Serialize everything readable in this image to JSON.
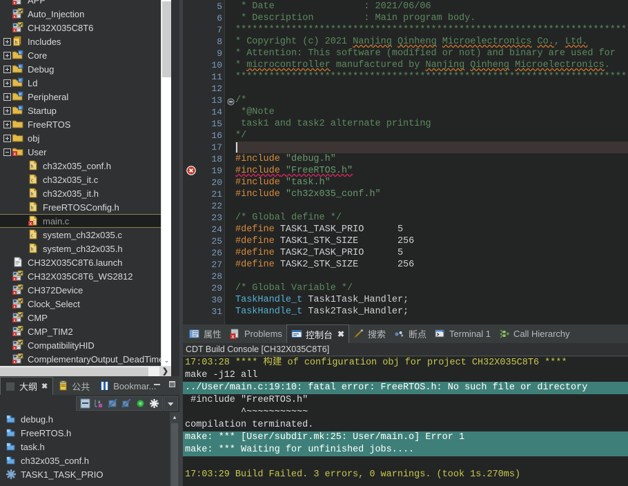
{
  "project_explorer": {
    "tree": [
      {
        "indent": 0,
        "twisty": "none",
        "icon": "project-c-icon",
        "label": "APP",
        "selected": false
      },
      {
        "indent": 0,
        "twisty": "none",
        "icon": "project-c-icon",
        "label": "Auto_Injection",
        "selected": false
      },
      {
        "indent": 0,
        "twisty": "none",
        "icon": "project-c-icon",
        "label": "CH32X035C8T6",
        "selected": false
      },
      {
        "indent": 0,
        "twisty": "expand",
        "icon": "includes-icon",
        "label": "Includes",
        "selected": false
      },
      {
        "indent": 0,
        "twisty": "expand",
        "icon": "src-folder-icon",
        "label": "Core",
        "selected": false
      },
      {
        "indent": 0,
        "twisty": "expand",
        "icon": "src-folder-icon",
        "label": "Debug",
        "selected": false
      },
      {
        "indent": 0,
        "twisty": "expand",
        "icon": "src-folder-icon",
        "label": "Ld",
        "selected": false
      },
      {
        "indent": 0,
        "twisty": "expand",
        "icon": "src-folder-icon",
        "label": "Peripheral",
        "selected": false
      },
      {
        "indent": 0,
        "twisty": "expand",
        "icon": "src-folder-icon",
        "label": "Startup",
        "selected": false
      },
      {
        "indent": 0,
        "twisty": "expand",
        "icon": "folder-icon",
        "label": "FreeRTOS",
        "selected": false
      },
      {
        "indent": 0,
        "twisty": "expand",
        "icon": "folder-icon",
        "label": "obj",
        "selected": false
      },
      {
        "indent": 0,
        "twisty": "collapse",
        "icon": "folder-error-icon",
        "label": "User",
        "selected": false
      },
      {
        "indent": 1,
        "twisty": "none",
        "icon": "h-file-icon",
        "label": "ch32x035_conf.h",
        "selected": false
      },
      {
        "indent": 1,
        "twisty": "none",
        "icon": "c-file-icon",
        "label": "ch32x035_it.c",
        "selected": false
      },
      {
        "indent": 1,
        "twisty": "none",
        "icon": "h-file-icon",
        "label": "ch32x035_it.h",
        "selected": false
      },
      {
        "indent": 1,
        "twisty": "none",
        "icon": "h-file-icon",
        "label": "FreeRTOSConfig.h",
        "selected": false
      },
      {
        "indent": 1,
        "twisty": "none",
        "icon": "c-file-error-icon",
        "label": "main.c",
        "selected": true
      },
      {
        "indent": 1,
        "twisty": "none",
        "icon": "c-file-icon",
        "label": "system_ch32x035.c",
        "selected": false
      },
      {
        "indent": 1,
        "twisty": "none",
        "icon": "h-file-icon",
        "label": "system_ch32x035.h",
        "selected": false
      },
      {
        "indent": 0,
        "twisty": "none",
        "icon": "launch-file-icon",
        "label": "CH32X035C8T6.launch",
        "selected": false
      },
      {
        "indent": 0,
        "twisty": "none",
        "icon": "project-c-icon",
        "label": "CH32X035C8T6_WS2812",
        "selected": false
      },
      {
        "indent": 0,
        "twisty": "none",
        "icon": "project-c-icon",
        "label": "CH372Device",
        "selected": false
      },
      {
        "indent": 0,
        "twisty": "none",
        "icon": "project-c-icon",
        "label": "Clock_Select",
        "selected": false
      },
      {
        "indent": 0,
        "twisty": "none",
        "icon": "project-c-icon",
        "label": "CMP",
        "selected": false
      },
      {
        "indent": 0,
        "twisty": "none",
        "icon": "project-c-icon",
        "label": "CMP_TIM2",
        "selected": false
      },
      {
        "indent": 0,
        "twisty": "none",
        "icon": "project-c-icon",
        "label": "CompatibilityHID",
        "selected": false
      },
      {
        "indent": 0,
        "twisty": "none",
        "icon": "project-c-icon",
        "label": "ComplementaryOutput_DeadTime",
        "selected": false
      }
    ],
    "hscroll_right_arrow": "❯",
    "vscroll_down_arrow": "⌄"
  },
  "outline": {
    "tabs": [
      {
        "label": "大纲",
        "icon": "outline-icon",
        "active": true,
        "closable": true
      },
      {
        "label": "公共",
        "icon": "clipboard-icon",
        "active": false,
        "closable": false
      },
      {
        "label": "Bookmar...",
        "icon": "bookmark-icon",
        "active": false,
        "closable": false
      }
    ],
    "window_buttons": [
      "minimize",
      "maximize"
    ],
    "toolbar_icons": [
      "collapse-all-icon",
      "sort-icon",
      "hide-fields-icon",
      "hide-static-icon",
      "hide-nonpublic-icon",
      "hide-macros-icon"
    ],
    "menu_icon": "view-menu-icon",
    "items": [
      {
        "icon": "include-icon",
        "label": "debug.h"
      },
      {
        "icon": "include-icon",
        "label": "FreeRTOS.h"
      },
      {
        "icon": "include-icon",
        "label": "task.h"
      },
      {
        "icon": "include-icon",
        "label": "ch32x035_conf.h"
      },
      {
        "icon": "macro-icon",
        "label": "TASK1_TASK_PRIO"
      }
    ]
  },
  "editor": {
    "current_line": 17,
    "error_line": 19,
    "fold_line": 13,
    "lines": [
      {
        "n": 5,
        "tokens": [
          {
            "t": " * Date                : 2021/06/06",
            "c": "cm"
          }
        ]
      },
      {
        "n": 6,
        "tokens": [
          {
            "t": " * Description         : Main program body.",
            "c": "cm"
          }
        ]
      },
      {
        "n": 7,
        "tokens": [
          {
            "t": "*******************************************************************************",
            "c": "cm"
          }
        ]
      },
      {
        "n": 8,
        "tokens": [
          {
            "t": "* Copyright (c) 2021 ",
            "c": "cm"
          },
          {
            "t": "Nanjing",
            "c": "cm wavy-orange"
          },
          {
            "t": " ",
            "c": "cm"
          },
          {
            "t": "Qinheng",
            "c": "cm wavy-orange"
          },
          {
            "t": " ",
            "c": "cm"
          },
          {
            "t": "Microelectronics",
            "c": "cm wavy-orange"
          },
          {
            "t": " ",
            "c": "cm"
          },
          {
            "t": "Co.",
            "c": "cm wavy-orange"
          },
          {
            "t": ", ",
            "c": "cm"
          },
          {
            "t": "Ltd.",
            "c": "cm wavy-orange"
          }
        ]
      },
      {
        "n": 9,
        "tokens": [
          {
            "t": "* Attention: This software (modified or not) and binary are used for",
            "c": "cm"
          }
        ]
      },
      {
        "n": 10,
        "tokens": [
          {
            "t": "* ",
            "c": "cm"
          },
          {
            "t": "microcontroller",
            "c": "cm wavy-orange"
          },
          {
            "t": " manufactured by ",
            "c": "cm"
          },
          {
            "t": "Nanjing",
            "c": "cm wavy-orange"
          },
          {
            "t": " ",
            "c": "cm"
          },
          {
            "t": "Qinheng",
            "c": "cm wavy-orange"
          },
          {
            "t": " ",
            "c": "cm"
          },
          {
            "t": "Microelectronics",
            "c": "cm wavy-orange"
          },
          {
            "t": ".",
            "c": "cm"
          }
        ]
      },
      {
        "n": 11,
        "tokens": [
          {
            "t": "*******************************************************************************",
            "c": "cm"
          }
        ]
      },
      {
        "n": 12,
        "tokens": [
          {
            "t": "",
            "c": "pl"
          }
        ]
      },
      {
        "n": 13,
        "tokens": [
          {
            "t": "/*",
            "c": "cm"
          }
        ]
      },
      {
        "n": 14,
        "tokens": [
          {
            "t": " *@Note",
            "c": "cm"
          }
        ]
      },
      {
        "n": 15,
        "tokens": [
          {
            "t": " task1 and task2 alternate printing",
            "c": "cm"
          }
        ]
      },
      {
        "n": 16,
        "tokens": [
          {
            "t": "*/",
            "c": "cm"
          }
        ]
      },
      {
        "n": 17,
        "tokens": [
          {
            "t": "",
            "c": "pl"
          }
        ]
      },
      {
        "n": 18,
        "tokens": [
          {
            "t": "#include",
            "c": "pp"
          },
          {
            "t": " ",
            "c": "pl"
          },
          {
            "t": "\"debug.h\"",
            "c": "str"
          }
        ]
      },
      {
        "n": 19,
        "tokens": [
          {
            "t": "#include",
            "c": "pp wavy-red"
          },
          {
            "t": " ",
            "c": "pl wavy-red"
          },
          {
            "t": "\"FreeRTOS.h\"",
            "c": "str wavy-red"
          }
        ]
      },
      {
        "n": 20,
        "tokens": [
          {
            "t": "#include",
            "c": "pp"
          },
          {
            "t": " ",
            "c": "pl"
          },
          {
            "t": "\"task.h\"",
            "c": "str"
          }
        ]
      },
      {
        "n": 21,
        "tokens": [
          {
            "t": "#include",
            "c": "pp"
          },
          {
            "t": " ",
            "c": "pl"
          },
          {
            "t": "\"ch32x035_conf.h\"",
            "c": "str"
          }
        ]
      },
      {
        "n": 22,
        "tokens": [
          {
            "t": "",
            "c": "pl"
          }
        ]
      },
      {
        "n": 23,
        "tokens": [
          {
            "t": "/* Global define */",
            "c": "cm"
          }
        ]
      },
      {
        "n": 24,
        "tokens": [
          {
            "t": "#define",
            "c": "pp"
          },
          {
            "t": " TASK1_TASK_PRIO      ",
            "c": "pl"
          },
          {
            "t": "5",
            "c": "num"
          }
        ]
      },
      {
        "n": 25,
        "tokens": [
          {
            "t": "#define",
            "c": "pp"
          },
          {
            "t": " TASK1_STK_SIZE       ",
            "c": "pl"
          },
          {
            "t": "256",
            "c": "num"
          }
        ]
      },
      {
        "n": 26,
        "tokens": [
          {
            "t": "#define",
            "c": "pp"
          },
          {
            "t": " TASK2_TASK_PRIO      ",
            "c": "pl"
          },
          {
            "t": "5",
            "c": "num"
          }
        ]
      },
      {
        "n": 27,
        "tokens": [
          {
            "t": "#define",
            "c": "pp"
          },
          {
            "t": " TASK2_STK_SIZE       ",
            "c": "pl"
          },
          {
            "t": "256",
            "c": "num"
          }
        ]
      },
      {
        "n": 28,
        "tokens": [
          {
            "t": "",
            "c": "pl"
          }
        ]
      },
      {
        "n": 29,
        "tokens": [
          {
            "t": "/* Global Variable */",
            "c": "cm"
          }
        ]
      },
      {
        "n": 30,
        "tokens": [
          {
            "t": "TaskHandle_t",
            "c": "ty"
          },
          {
            "t": " Task1Task_Handler;",
            "c": "pl"
          }
        ]
      },
      {
        "n": 31,
        "tokens": [
          {
            "t": "TaskHandle_t",
            "c": "ty"
          },
          {
            "t": " Task2Task_Handler;",
            "c": "pl"
          }
        ]
      }
    ]
  },
  "console": {
    "tabs": [
      {
        "label": "属性",
        "icon": "properties-icon",
        "active": false,
        "closable": false
      },
      {
        "label": "Problems",
        "icon": "problems-icon",
        "active": false,
        "closable": false
      },
      {
        "label": "控制台",
        "icon": "console-icon",
        "active": true,
        "closable": true
      },
      {
        "label": "搜索",
        "icon": "search-icon",
        "active": false,
        "closable": false
      },
      {
        "label": "断点",
        "icon": "breakpoints-icon",
        "active": false,
        "closable": false
      },
      {
        "label": "Terminal 1",
        "icon": "terminal-icon",
        "active": false,
        "closable": false
      },
      {
        "label": "Call Hierarchy",
        "icon": "call-hierarchy-icon",
        "active": false,
        "closable": false
      }
    ],
    "title": "CDT Build Console [CH32X035C8T6]",
    "output": [
      {
        "segments": [
          {
            "t": "17:03:28 **** ",
            "c": "o-yellow"
          },
          {
            "t": "构建",
            "c": "o-yellow"
          },
          {
            "t": " of configuration obj for project CH32X035C8T6 ****",
            "c": "o-yellow"
          }
        ],
        "hl": false
      },
      {
        "segments": [
          {
            "t": "make -j12 all",
            "c": "o-white"
          }
        ],
        "hl": false
      },
      {
        "segments": [
          {
            "t": "../User/main.c:19:10: fatal error: FreeRTOS.h: No such file or directory",
            "c": ""
          }
        ],
        "hl": true
      },
      {
        "segments": [
          {
            "t": " #include \"FreeRTOS.h\"",
            "c": "o-white"
          }
        ],
        "hl": false
      },
      {
        "segments": [
          {
            "t": "          ^~~~~~~~~~~~",
            "c": "o-white"
          }
        ],
        "hl": false
      },
      {
        "segments": [
          {
            "t": "compilation terminated.",
            "c": "o-white"
          }
        ],
        "hl": false
      },
      {
        "segments": [
          {
            "t": "make: *** [User/subdir.mk:25: User/main.o] Error 1",
            "c": ""
          }
        ],
        "hl": true
      },
      {
        "segments": [
          {
            "t": "make: *** Waiting for unfinished jobs....",
            "c": ""
          }
        ],
        "hl": true
      },
      {
        "segments": [
          {
            "t": "",
            "c": "o-white"
          }
        ],
        "hl": false
      },
      {
        "segments": [
          {
            "t": "17:03:29 Build Failed. 3 errors, 0 warnings. (took 1s.270ms)",
            "c": "o-yellow"
          }
        ],
        "hl": false
      }
    ]
  },
  "colors": {
    "panel_bg": "#2f3132",
    "editor_bg": "#232525",
    "gutter_bg": "#2b2d2e",
    "tab_bar_bg": "#383c3d",
    "comment_green": "#5c8a5c",
    "preproc_orange": "#d98b3a",
    "type_blue": "#55b0d4",
    "line_num_blue": "#7d9cc0",
    "error_red": "#d5245c",
    "console_yellow": "#c8c84a",
    "console_error_hl": "#3e8079",
    "selection_border": "#8a7f55"
  }
}
